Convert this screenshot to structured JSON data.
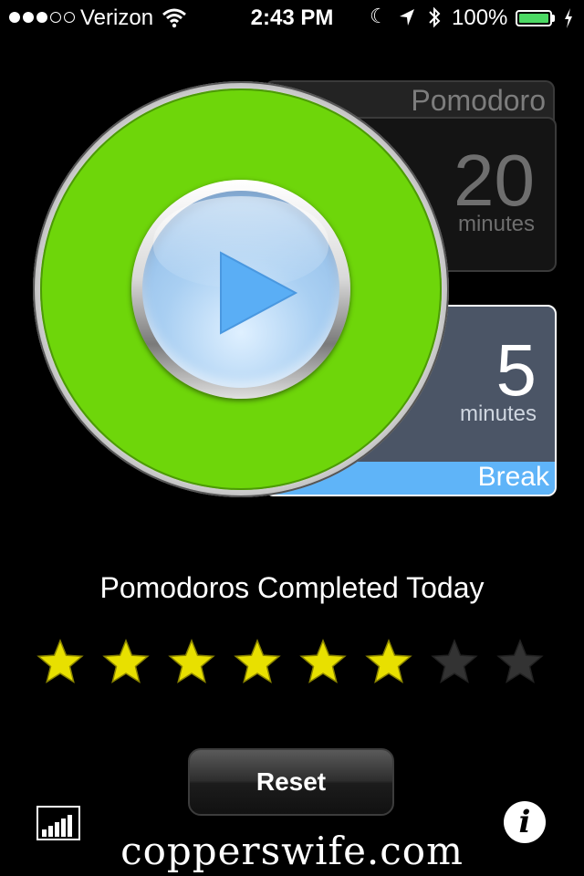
{
  "status_bar": {
    "signal_bars_filled": 3,
    "signal_bars_total": 5,
    "carrier": "Verizon",
    "time": "2:43 PM",
    "battery_percent": "100%",
    "icons": [
      "wifi-icon",
      "moon-icon",
      "location-arrow-icon",
      "bluetooth-icon",
      "battery-icon",
      "charging-icon"
    ],
    "battery_color": "#4cd964"
  },
  "pomodoro": {
    "label": "Pomodoro",
    "value": "20",
    "unit": "minutes"
  },
  "break": {
    "label": "Break",
    "value": "5",
    "unit": "minutes",
    "accent_color": "#5fb4f8"
  },
  "dial": {
    "ring_color": "#6ed60a",
    "button_icon": "play-icon"
  },
  "completed": {
    "title": "Pomodoros Completed Today",
    "filled": 6,
    "total": 8,
    "filled_color": "#e8e000",
    "empty_color": "#333333"
  },
  "footer": {
    "reset_label": "Reset",
    "stats_icon": "bar-chart-icon",
    "info_icon": "info-icon",
    "watermark": "copperswife.com"
  }
}
